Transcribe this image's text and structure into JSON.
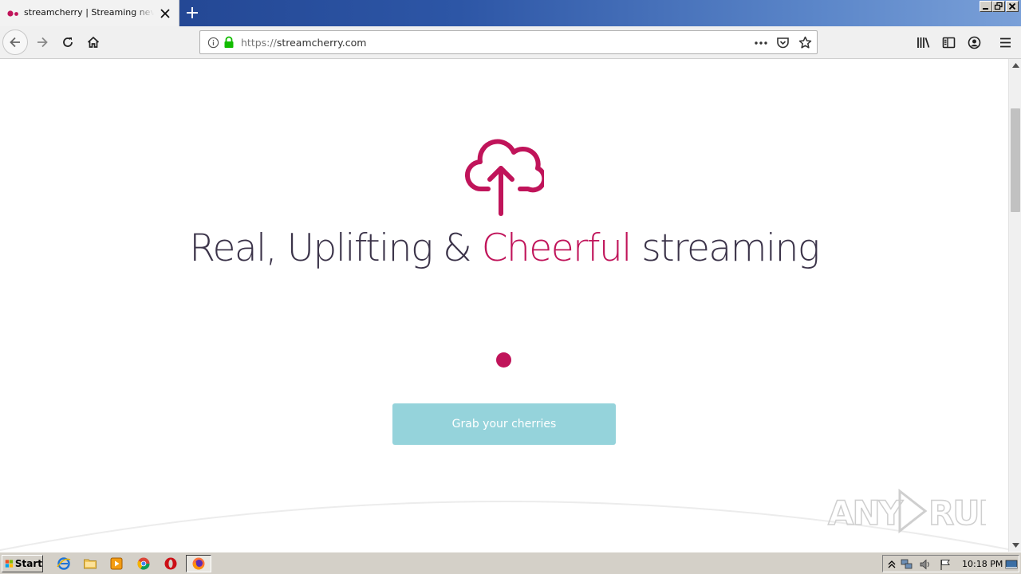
{
  "browser": {
    "tab": {
      "title": "streamcherry | Streaming never been",
      "favicon": "cherry-icon"
    },
    "new_tab_icon": "plus-icon",
    "url": {
      "protocol": "https://",
      "host": "streamcherry.com"
    },
    "toolbar_icons": [
      "back-icon",
      "forward-icon",
      "reload-icon",
      "home-icon",
      "info-icon",
      "lock-icon",
      "more-icon",
      "pocket-icon",
      "bookmark-star-icon",
      "library-icon",
      "sidebar-icon",
      "account-icon",
      "menu-icon"
    ]
  },
  "page": {
    "hero_icon": "cloud-upload-icon",
    "headline": {
      "part1": "Real, Uplifting & ",
      "accent": "Cheerful",
      "part2": " streaming"
    },
    "cta_label": "Grab your cherries",
    "watermark": "ANY RUN",
    "colors": {
      "accent": "#c0145a",
      "headline": "#3b3349",
      "cta_bg": "#95d3db"
    }
  },
  "taskbar": {
    "start_label": "Start",
    "apps": [
      "ie-icon",
      "folder-icon",
      "media-player-icon",
      "chrome-icon",
      "opera-icon",
      "firefox-icon"
    ],
    "clock": "10:18 PM"
  }
}
